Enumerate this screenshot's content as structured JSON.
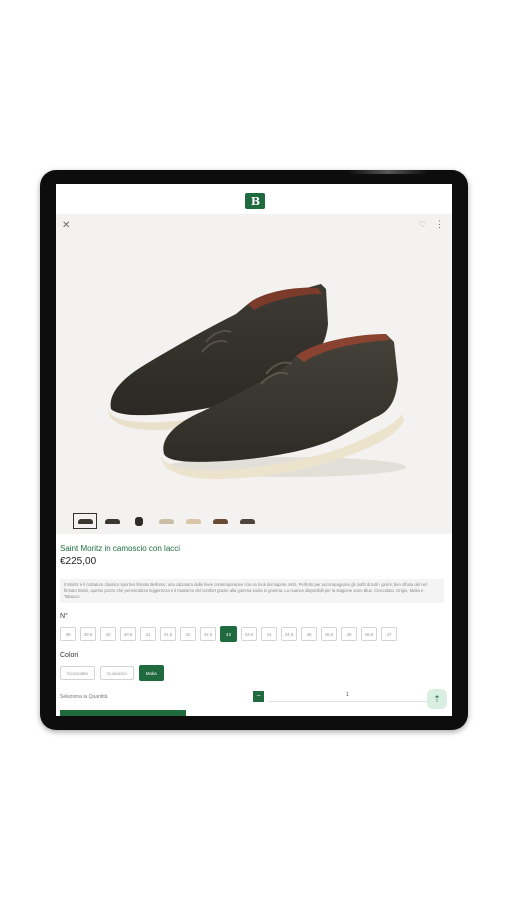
{
  "app": {
    "logo_text": "B"
  },
  "icons": {
    "close": "close-icon",
    "wishlist": "heart-icon",
    "more": "more-vert-icon",
    "scroll_top": "arrow-up-icon"
  },
  "product": {
    "title": "Saint Moritz in camoscio con lacci",
    "price": "€225,00",
    "description": "Il Moritz è il calzaturo classico sportivo firmato Bellomo: una calzatura dalle linee contemporanee con un look dal sapore retrò. Perfetto per accompagnarvi gli outfit di tutti i giorni, ben offusa del nel firmato Bossi, questo pezzo che personalizza leggerezza e il massimo del comfort grazie alla gomma suola in gomma. La nuance disponibili per la stagione sono Blue, Cioccolato, Grigio, Moka e Tabacco."
  },
  "thumbnails_count": 7,
  "size_label": "N°",
  "sizes": [
    "39",
    "39.5",
    "40",
    "40.5",
    "41",
    "41.5",
    "42",
    "42.5",
    "43",
    "43.5",
    "44",
    "44.5",
    "45",
    "45.5",
    "46",
    "46.5",
    "47"
  ],
  "selected_size": "43",
  "color_label": "Colori",
  "colors": [
    "Cioccolato",
    "Cuoiaccio",
    "Moka"
  ],
  "selected_color": "Moka",
  "quantity": {
    "label": "Seleziona la Quantità",
    "minus": "−",
    "value": "1"
  },
  "theme": {
    "accent": "#1f6b3f",
    "accent_light": "#d9efe2"
  }
}
